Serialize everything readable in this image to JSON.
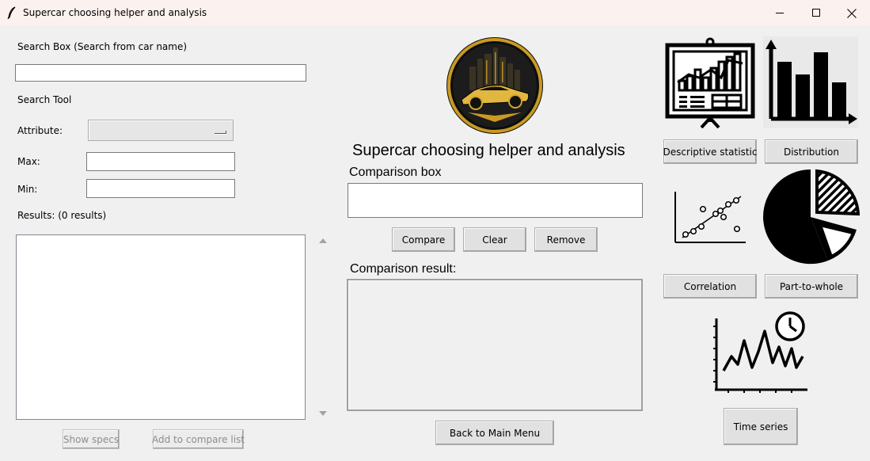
{
  "window": {
    "title": "Supercar choosing helper and analysis",
    "icons": [
      "feather-icon",
      "minimize-icon",
      "maximize-icon",
      "close-icon"
    ]
  },
  "search": {
    "box_label": "Search Box (Search from car name)",
    "box_value": "",
    "tool_label": "Search Tool",
    "attribute_label": "Attribute:",
    "attribute_value": "",
    "max_label": "Max:",
    "max_value": "",
    "min_label": "Min:",
    "min_value": "",
    "results_label": "Results: (0 results)",
    "results": [],
    "show_specs_label": "Show specs",
    "add_compare_label": "Add to compare list"
  },
  "center": {
    "logo": "supercar-logo",
    "heading": "Supercar choosing helper and analysis",
    "comparison_box_label": "Comparison box",
    "comparison_box_value": "",
    "compare_label": "Compare",
    "clear_label": "Clear",
    "remove_label": "Remove",
    "comparison_result_label": "Comparison result:",
    "back_label": "Back to Main Menu"
  },
  "analysis": {
    "descriptive_label": "Descriptive statistic",
    "distribution_label": "Distribution",
    "correlation_label": "Correlation",
    "part_to_whole_label": "Part-to-whole",
    "time_series_label": "Time series",
    "icons": [
      "presentation-chart-icon",
      "bar-chart-icon",
      "scatter-plot-icon",
      "pie-chart-icon",
      "time-series-icon"
    ]
  },
  "colors": {
    "gold": "#d4a62a",
    "window_bg": "#f0f0f0",
    "titlebar_bg": "#fbf1ef"
  }
}
